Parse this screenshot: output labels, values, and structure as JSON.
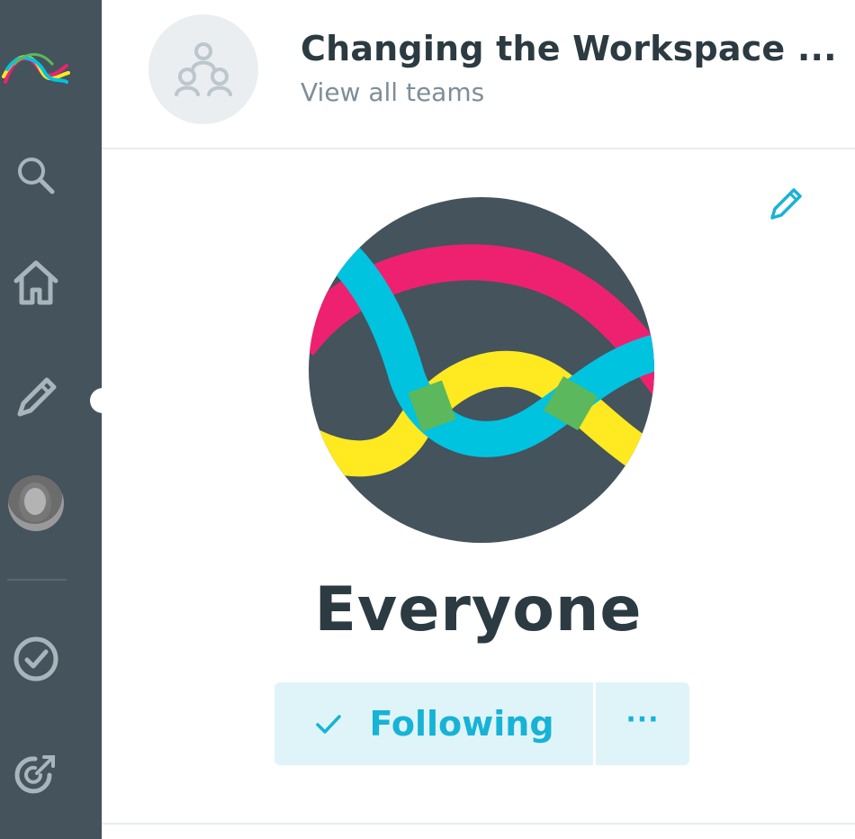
{
  "header": {
    "title": "Changing the Workspace ...",
    "link": "View all teams"
  },
  "team": {
    "name": "Everyone",
    "follow_label": "Following",
    "more_label": "···"
  },
  "sidebar": {
    "items": [
      {
        "icon": "app-logo-icon"
      },
      {
        "icon": "search-icon"
      },
      {
        "icon": "home-icon"
      },
      {
        "icon": "pencil-icon"
      },
      {
        "icon": "avatar"
      },
      {
        "icon": "checkmark-circle-icon"
      },
      {
        "icon": "target-icon"
      }
    ]
  },
  "colors": {
    "sidebar_bg": "#44535c",
    "accent": "#17b3d6",
    "button_bg": "#dff4f9",
    "logo_pink": "#ee2170",
    "logo_cyan": "#00c3e0",
    "logo_yellow": "#ffe921",
    "logo_green": "#5cb85c",
    "logo_bg": "#44535c"
  }
}
